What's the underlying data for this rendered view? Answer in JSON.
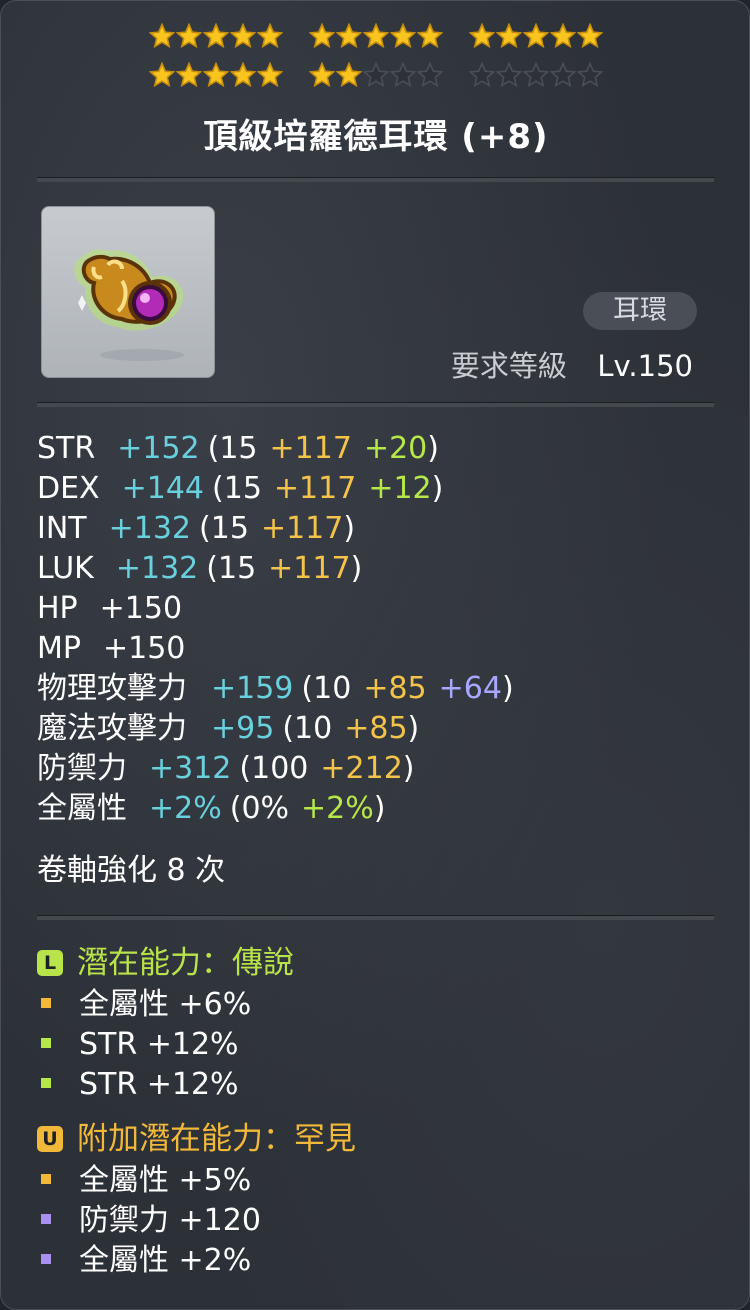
{
  "stars": {
    "filled": 22,
    "total": 30,
    "filled_color": "#f7c51e",
    "empty_color": "#2e3238"
  },
  "item": {
    "name": "頂級培羅德耳環 (+8)",
    "icon": "earring-icon",
    "type": "耳環",
    "req_label": "要求等級",
    "req_value": "Lv.150"
  },
  "stats": [
    {
      "label": "STR",
      "total": "+152",
      "open": "(",
      "base": "15",
      "scroll": "+117",
      "extra": "+20",
      "extra_kind": "green",
      "close": ")"
    },
    {
      "label": "DEX",
      "total": "+144",
      "open": "(",
      "base": "15",
      "scroll": "+117",
      "extra": "+12",
      "extra_kind": "green",
      "close": ")"
    },
    {
      "label": "INT",
      "total": "+132",
      "open": "(",
      "base": "15",
      "scroll": "+117",
      "close": ")"
    },
    {
      "label": "LUK",
      "total": "+132",
      "open": "(",
      "base": "15",
      "scroll": "+117",
      "close": ")"
    },
    {
      "label": "HP",
      "total": "+150"
    },
    {
      "label": "MP",
      "total": "+150"
    },
    {
      "label": "物理攻擊力",
      "total": "+159",
      "open": "(",
      "base": "10",
      "scroll": "+85",
      "extra": "+64",
      "extra_kind": "purple",
      "close": ")"
    },
    {
      "label": "魔法攻擊力",
      "total": "+95",
      "open": "(",
      "base": "10",
      "scroll": "+85",
      "close": ")"
    },
    {
      "label": "防禦力",
      "total": "+312",
      "open": "(",
      "base": "100",
      "scroll": "+212",
      "close": ")"
    },
    {
      "label": "全屬性",
      "total": "+2%",
      "open": "(",
      "base": "0%",
      "scroll": "+2%",
      "scroll_kind": "green",
      "close": ")"
    }
  ],
  "upgrade_text": "卷軸強化 8 次",
  "potential": {
    "badge": "L",
    "title": "潛在能力：傳說",
    "color": "#b9e34a",
    "lines": [
      {
        "text": "全屬性 +6%",
        "bullet_color": "#f1b83a"
      },
      {
        "text": "STR +12%",
        "bullet_color": "#b7e84a"
      },
      {
        "text": "STR +12%",
        "bullet_color": "#b7e84a"
      }
    ]
  },
  "additional_potential": {
    "badge": "U",
    "title": "附加潛在能力：罕見",
    "color": "#f1b83a",
    "lines": [
      {
        "text": "全屬性 +5%",
        "bullet_color": "#f1b83a"
      },
      {
        "text": "防禦力 +120",
        "bullet_color": "#a98ff0"
      },
      {
        "text": "全屬性 +2%",
        "bullet_color": "#a98ff0"
      }
    ]
  }
}
